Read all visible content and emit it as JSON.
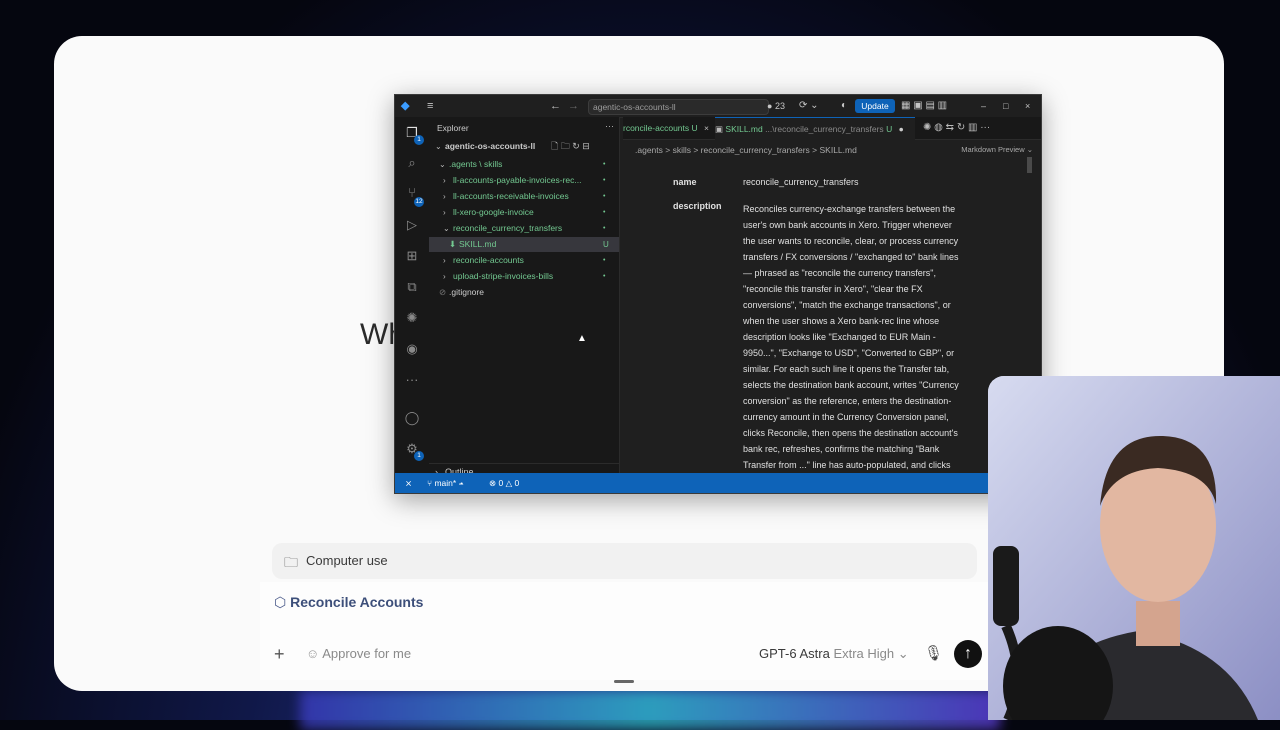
{
  "vscode": {
    "search_text": "agentic-os-accounts-ll",
    "notif_count": "23",
    "update_label": "Update",
    "explorer_title": "Explorer",
    "root_folder": "agentic-os-accounts-ll",
    "tree": [
      {
        "label": ".agents \\ skills",
        "status": "•"
      },
      {
        "label": "ll-accounts-payable-invoices-rec...",
        "status": "•"
      },
      {
        "label": "ll-accounts-receivable-invoices",
        "status": "•"
      },
      {
        "label": "ll-xero-google-invoice",
        "status": "•"
      },
      {
        "label": "reconcile_currency_transfers",
        "status": "•"
      },
      {
        "label": "SKILL.md",
        "status": "U"
      },
      {
        "label": "reconcile-accounts",
        "status": "•"
      },
      {
        "label": "upload-stripe-invoices-bills",
        "status": "•"
      },
      {
        "label": ".gitignore",
        "status": ""
      }
    ],
    "outline_label": "Outline",
    "activity_badge_scm": "12",
    "activity_badge_settings": "1",
    "activity_badge_explorer": "1",
    "tabs": [
      {
        "label": "rconcile-accounts",
        "status": "U"
      },
      {
        "label": "SKILL.md",
        "path": "...\\reconcile_currency_transfers",
        "status": "U"
      }
    ],
    "breadcrumb": ".agents  >  skills  >  reconcile_currency_transfers  >  SKILL.md",
    "preview_mode": "Markdown Preview",
    "name_key": "name",
    "name_value": "reconcile_currency_transfers",
    "description_key": "description",
    "description_lines": [
      "Reconciles currency-exchange transfers between the",
      "user's own bank accounts in Xero. Trigger whenever",
      "the user wants to reconcile, clear, or process currency",
      "transfers / FX conversions / \"exchanged to\" bank lines",
      "— phrased as \"reconcile the currency transfers\",",
      "\"reconcile this transfer in Xero\", \"clear the FX",
      "conversions\", \"match the exchange transactions\", or",
      "when the user shows a Xero bank-rec line whose",
      "description looks like \"Exchanged to EUR Main -",
      "9950...\", \"Exchange to USD\", \"Converted to GBP\", or",
      "similar. For each such line it opens the Transfer tab,",
      "selects the destination bank account, writes \"Currency",
      "conversion\" as the reference, enters the destination-",
      "currency amount in the Currency Conversion panel,",
      "clicks Reconcile, then opens the destination account's",
      "bank rec, refreshes, confirms the matching \"Bank",
      "Transfer from ...\" line has auto-populated, and clicks"
    ],
    "status_branch": "main*",
    "status_errors": "0",
    "status_warnings": "0"
  },
  "background_heading": "Wh",
  "composer": {
    "computer_use_label": "Computer use",
    "skill_label": "Reconcile Accounts",
    "placeholder": "Approve for me",
    "model_name": "GPT-6 Astra",
    "model_effort": "Extra High"
  }
}
